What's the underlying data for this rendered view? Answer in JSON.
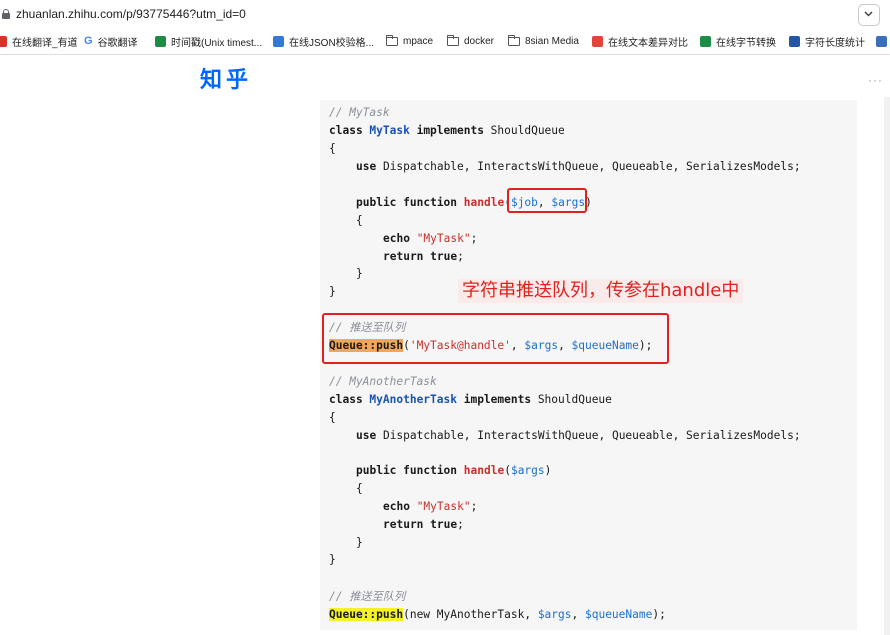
{
  "browser": {
    "url": "zhuanlan.zhihu.com/p/93775446?utm_id=0"
  },
  "bookmarks": [
    {
      "label": "在线翻译_有道",
      "icon": "youdao-icon",
      "color": "#d9322a"
    },
    {
      "label": "谷歌翻译",
      "icon": "google-icon",
      "color": "#4285f4"
    },
    {
      "label": "时间戳(Unix timest...",
      "icon": "timestamp-icon",
      "color": "#1e8c45"
    },
    {
      "label": "在线JSON校验格...",
      "icon": "json-icon",
      "color": "#2f7bd6"
    },
    {
      "label": "mpace",
      "icon": "folder-icon"
    },
    {
      "label": "docker",
      "icon": "folder-icon"
    },
    {
      "label": "8sian Media",
      "icon": "folder-icon"
    },
    {
      "label": "在线文本差异对比",
      "icon": "diff-icon",
      "color": "#e0443a"
    },
    {
      "label": "在线字节转换",
      "icon": "pen-icon",
      "color": "#1e8c45"
    },
    {
      "label": "字符长度统计",
      "icon": "u-icon",
      "color": "#2456a6"
    }
  ],
  "site": {
    "logo": "知乎",
    "more": "···"
  },
  "code": {
    "l1": "// MyTask",
    "l2_kw": "class ",
    "l2_cls": "MyTask",
    "l2_kw2": " implements ",
    "l2_rest": "ShouldQueue",
    "l3": "{",
    "l4_kw": "use ",
    "l4_rest": "Dispatchable, InteractsWithQueue, Queueable, SerializesModels;",
    "l5_kw": "public function ",
    "l5_fn": "handle",
    "l5_p1": "(",
    "l5_v1": "$job",
    "l5_p2": ", ",
    "l5_v2": "$args",
    "l5_p3": ")",
    "l6": "{",
    "l7_kw": "echo ",
    "l7_str": "\"MyTask\"",
    "l7_end": ";",
    "l8_kw": "return ",
    "l8_kw2": "true",
    "l8_end": ";",
    "l9": "}",
    "l10": "}",
    "l11": "// 推送至队列",
    "l12_hl": "Queue::push",
    "l12_p1": "(",
    "l12_str": "'MyTask@handle'",
    "l12_p2": ", ",
    "l12_v1": "$args",
    "l12_p3": ", ",
    "l12_v2": "$queueName",
    "l12_p4": ");",
    "l13": "// MyAnotherTask",
    "l14_kw": "class ",
    "l14_cls": "MyAnotherTask",
    "l14_kw2": " implements ",
    "l14_rest": "ShouldQueue",
    "l15": "{",
    "l16_kw": "use ",
    "l16_rest": "Dispatchable, InteractsWithQueue, Queueable, SerializesModels;",
    "l17_kw": "public function ",
    "l17_fn": "handle",
    "l17_p1": "(",
    "l17_v1": "$args",
    "l17_p2": ")",
    "l18": "{",
    "l19_kw": "echo ",
    "l19_str": "\"MyTask\"",
    "l19_end": ";",
    "l20_kw": "return ",
    "l20_kw2": "true",
    "l20_end": ";",
    "l21": "}",
    "l22": "}",
    "l23": "// 推送至队列",
    "l24_hl": "Queue::push",
    "l24_p1": "(new MyAnotherTask, ",
    "l24_v1": "$args",
    "l24_p2": ", ",
    "l24_v2": "$queueName",
    "l24_p3": ");"
  },
  "annotation": {
    "text": "字符串推送队列，传参在handle中",
    "color": "#e0221e"
  }
}
